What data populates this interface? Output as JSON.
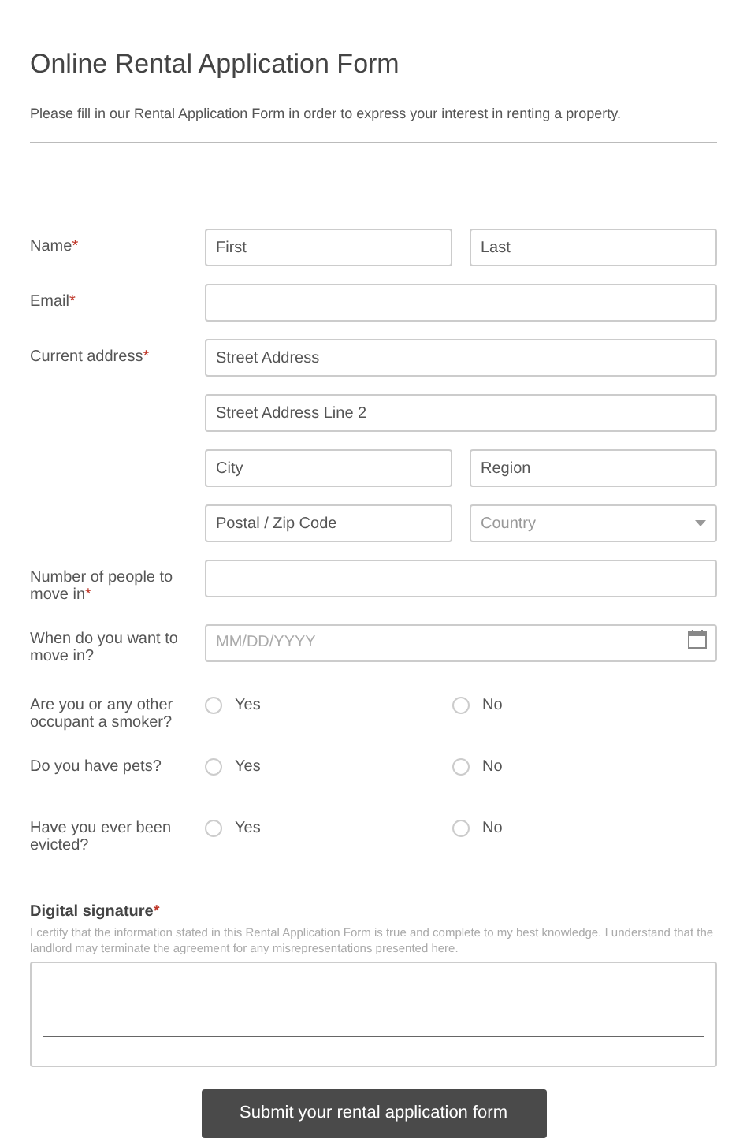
{
  "title": "Online Rental Application Form",
  "description": "Please fill in our Rental Application Form in order to express your interest in renting a property.",
  "rows": [
    {
      "kind": "fields",
      "label": "Name",
      "required_mark": "*",
      "lines": [
        [
          {
            "kind": "text",
            "placeholder": "First"
          },
          {
            "kind": "text",
            "placeholder": "Last"
          }
        ]
      ]
    },
    {
      "kind": "fields",
      "label": "Email",
      "required_mark": "*",
      "lines": [
        [
          {
            "kind": "text"
          }
        ]
      ]
    },
    {
      "kind": "fields",
      "label": "Current address",
      "required_mark": "*",
      "lines": [
        [
          {
            "kind": "text",
            "placeholder": "Street Address"
          }
        ],
        [
          {
            "kind": "text",
            "placeholder": "Street Address Line 2"
          }
        ],
        [
          {
            "kind": "text",
            "placeholder": "City"
          },
          {
            "kind": "text",
            "placeholder": "Region"
          }
        ],
        [
          {
            "kind": "text",
            "placeholder": "Postal / Zip Code"
          },
          {
            "kind": "select",
            "placeholder": "Country"
          }
        ]
      ]
    },
    {
      "kind": "fields",
      "label": "Number of people to move in",
      "required_mark": "*",
      "lines": [
        [
          {
            "kind": "text"
          }
        ]
      ]
    },
    {
      "kind": "fields",
      "label": "When do you want to move in?",
      "lines": [
        [
          {
            "kind": "date",
            "placeholder": "MM/DD/YYYY"
          }
        ]
      ]
    },
    {
      "kind": "radio",
      "label": "Are you or any other occupant a smoker?",
      "options": [
        {
          "label": "Yes",
          "selected": false
        },
        {
          "label": "No",
          "selected": false
        }
      ]
    },
    {
      "kind": "radio",
      "label": "Do you have pets?",
      "options": [
        {
          "label": "Yes",
          "selected": false
        },
        {
          "label": "No",
          "selected": false
        }
      ]
    },
    {
      "kind": "radio",
      "label": "Have you ever been evicted?",
      "options": [
        {
          "label": "Yes",
          "selected": false
        },
        {
          "label": "No",
          "selected": false
        }
      ]
    }
  ],
  "signature": {
    "label": "Digital signature",
    "required_mark": "*",
    "note": "I certify that the information stated in this Rental Application Form is true and complete to my best knowledge. I understand that the landlord may terminate the agreement for any misrepresentations presented here."
  },
  "submit": "Submit your rental application form"
}
